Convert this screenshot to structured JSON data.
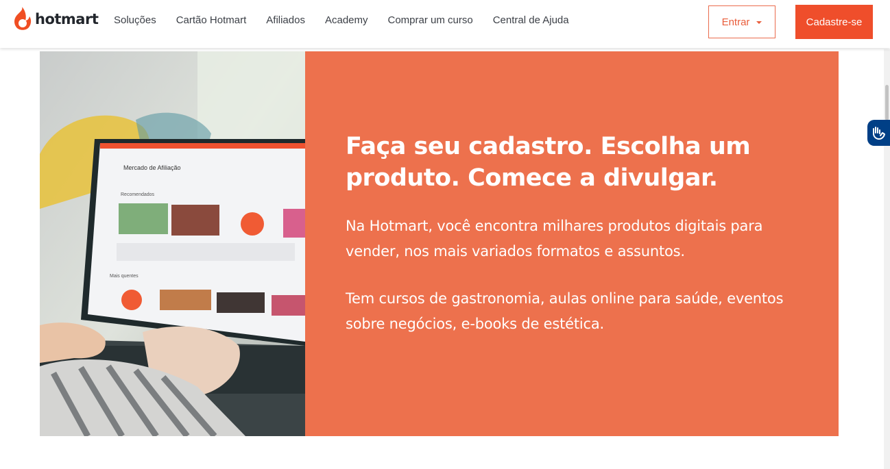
{
  "header": {
    "logo_text": "hotmart",
    "nav": [
      "Soluções",
      "Cartão Hotmart",
      "Afiliados",
      "Academy",
      "Comprar um curso",
      "Central de Ajuda"
    ],
    "login_label": "Entrar",
    "signup_label": "Cadastre-se"
  },
  "hero": {
    "title": "Faça seu cadastro. Escolha um produto. Comece a divulgar.",
    "paragraph_1": "Na Hotmart, você encontra milhares produtos digitais para vender, nos mais variados formatos e assuntos.",
    "paragraph_2": "Tem cursos de gastronomia, aulas online para saúde, eventos sobre negócios, e-books de estética.",
    "photo_screen": {
      "heading": "Mercado de Afiliação",
      "section_1": "Recomendados",
      "section_2": "Mais quentes"
    }
  },
  "colors": {
    "brand": "#ef4e2b",
    "panel": "#ed714d",
    "accessibility": "#003f86"
  },
  "icons": {
    "logo": "hotmart-flame-icon",
    "dropdown": "caret-down-icon",
    "accessibility": "sign-language-icon"
  }
}
